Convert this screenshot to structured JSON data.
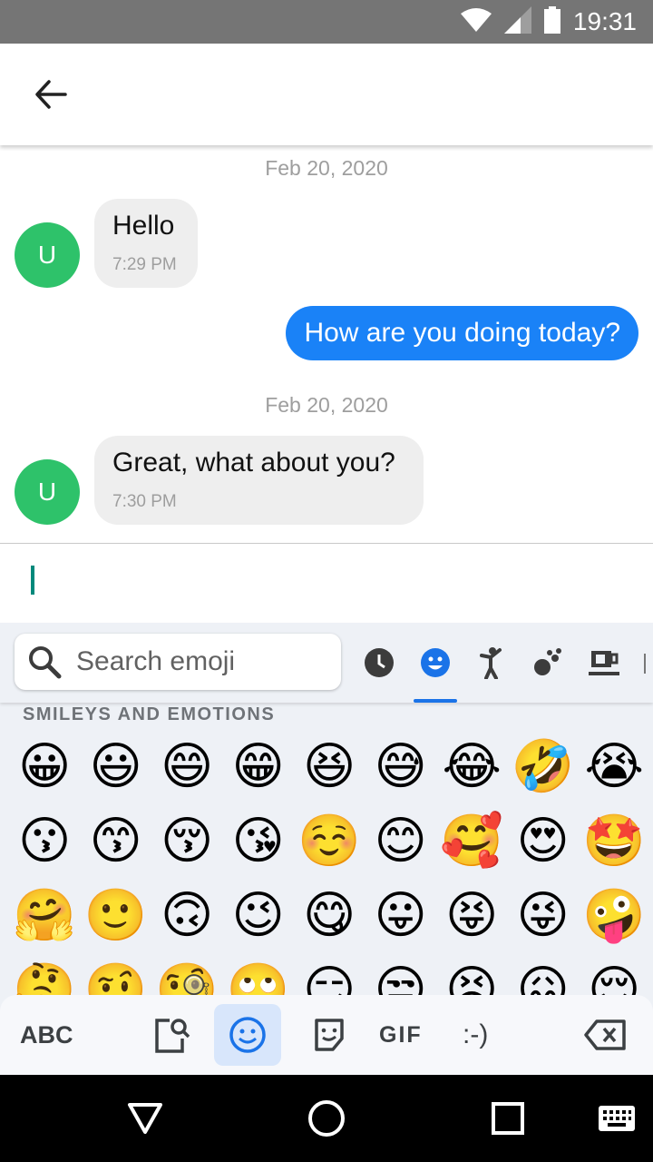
{
  "status_bar": {
    "time": "19:31",
    "icons": [
      "wifi-icon",
      "signal-icon",
      "battery-icon"
    ]
  },
  "app_bar": {
    "back_icon": "arrow-left-icon"
  },
  "messages": [
    {
      "type": "date",
      "text": "Feb 20, 2020"
    },
    {
      "type": "incoming",
      "avatar": "U",
      "text": "Hello",
      "time": "7:29 PM"
    },
    {
      "type": "outgoing",
      "text": "How are you doing today?"
    },
    {
      "type": "date",
      "text": "Feb 20, 2020"
    },
    {
      "type": "incoming",
      "avatar": "U",
      "text": "Great, what about you?",
      "time": "7:30 PM"
    }
  ],
  "keyboard": {
    "search_placeholder": "Search emoji",
    "categories": [
      "recent-clock-icon",
      "smiley-face-icon",
      "person-icon",
      "animals-icon",
      "food-drink-icon"
    ],
    "active_category": "smiley-face-icon",
    "section_title": "SMILEYS AND EMOTIONS",
    "emoji_rows": [
      [
        "😀",
        "😃",
        "😄",
        "😁",
        "😆",
        "😅",
        "😂",
        "🤣",
        "😭"
      ],
      [
        "😗",
        "😙",
        "😚",
        "😘",
        "☺️",
        "😊",
        "🥰",
        "😍",
        "🤩"
      ],
      [
        "🤗",
        "🙂",
        "🙃",
        "😉",
        "😋",
        "😛",
        "😝",
        "😜",
        "🤪"
      ],
      [
        "🤔",
        "🤨",
        "🧐",
        "🙄",
        "😏",
        "😒",
        "😣",
        "😖",
        "😌"
      ]
    ],
    "toolbar": {
      "abc_label": "ABC",
      "gif_label": "GIF",
      "emoticon_label": ":-)",
      "icons": [
        "clipboard-search-icon",
        "emoji-icon",
        "sticker-icon",
        "backspace-icon"
      ]
    }
  },
  "nav_bar": {
    "icons": [
      "back-triangle-icon",
      "home-circle-icon",
      "recents-square-icon",
      "keyboard-icon"
    ]
  },
  "colors": {
    "accent": "#1a82f7",
    "avatar": "#2ec26a",
    "status_bar": "#757575",
    "cursor": "#00897b"
  }
}
